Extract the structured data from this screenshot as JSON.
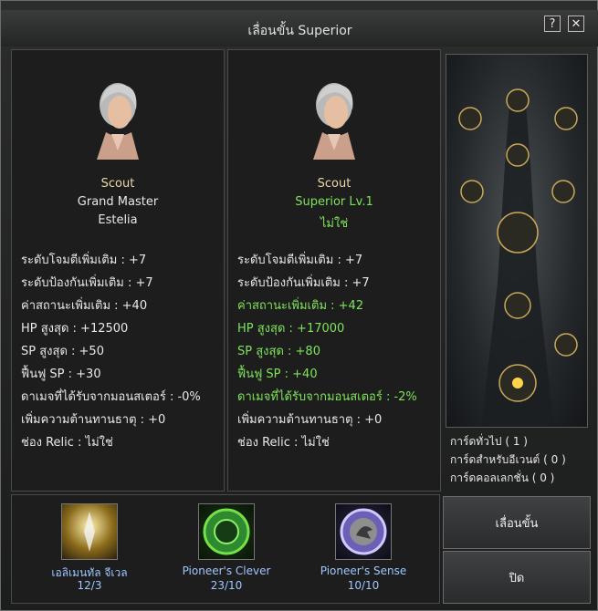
{
  "window": {
    "title": "เลื่อนขั้น Superior",
    "help_label": "?",
    "close_label": "✕"
  },
  "left": {
    "class_name": "Scout",
    "rank": "Grand Master",
    "name": "Estelia",
    "stats": [
      "ระดับโจมตีเพิ่มเติม : +7",
      "ระดับป้องกันเพิ่มเติม : +7",
      "ค่าสถานะเพิ่มเติม : +40",
      "HP สูงสุด : +12500",
      "SP สูงสุด : +50",
      "ฟื้นฟู SP : +30",
      "ดาเมจที่ได้รับจากมอนสเตอร์ : -0%",
      "เพิ่มความต้านทานธาตุ : +0",
      "ช่อง Relic : ไม่ใช่"
    ]
  },
  "right": {
    "class_name": "Scout",
    "rank": "Superior Lv.1",
    "name": "ไม่ใช่",
    "stats": [
      "ระดับโจมตีเพิ่มเติม : +7",
      "ระดับป้องกันเพิ่มเติม : +7",
      "ค่าสถานะเพิ่มเติม : +42",
      "HP สูงสุด : +17000",
      "SP สูงสุด : +80",
      "ฟื้นฟู SP : +40",
      "ดาเมจที่ได้รับจากมอนสเตอร์ : -2%",
      "เพิ่มความต้านทานธาตุ : +0",
      "ช่อง Relic : ไม่ใช่"
    ]
  },
  "cards": {
    "general": "การ์ดทั่วไป ( 1 )",
    "event": "การ์ดสำหรับอีเวนต์ ( 0 )",
    "collection": "การ์ดคอลเลกชั่น ( 0 )"
  },
  "materials": [
    {
      "label": "เอลิเมนทัล จีเวล",
      "count": "12/3",
      "icon": "elemental-jewel-icon"
    },
    {
      "label": "Pioneer's Clever",
      "count": "23/10",
      "icon": "pioneer-clever-icon"
    },
    {
      "label": "Pioneer's Sense",
      "count": "10/10",
      "icon": "pioneer-sense-icon"
    }
  ],
  "buttons": {
    "promote": "เลื่อนขั้น",
    "close": "ปิด"
  },
  "colors": {
    "green": "#7fe35a",
    "gold": "#e9d8a6",
    "red": "#ff4a4a",
    "blue": "#9ec7ff"
  }
}
